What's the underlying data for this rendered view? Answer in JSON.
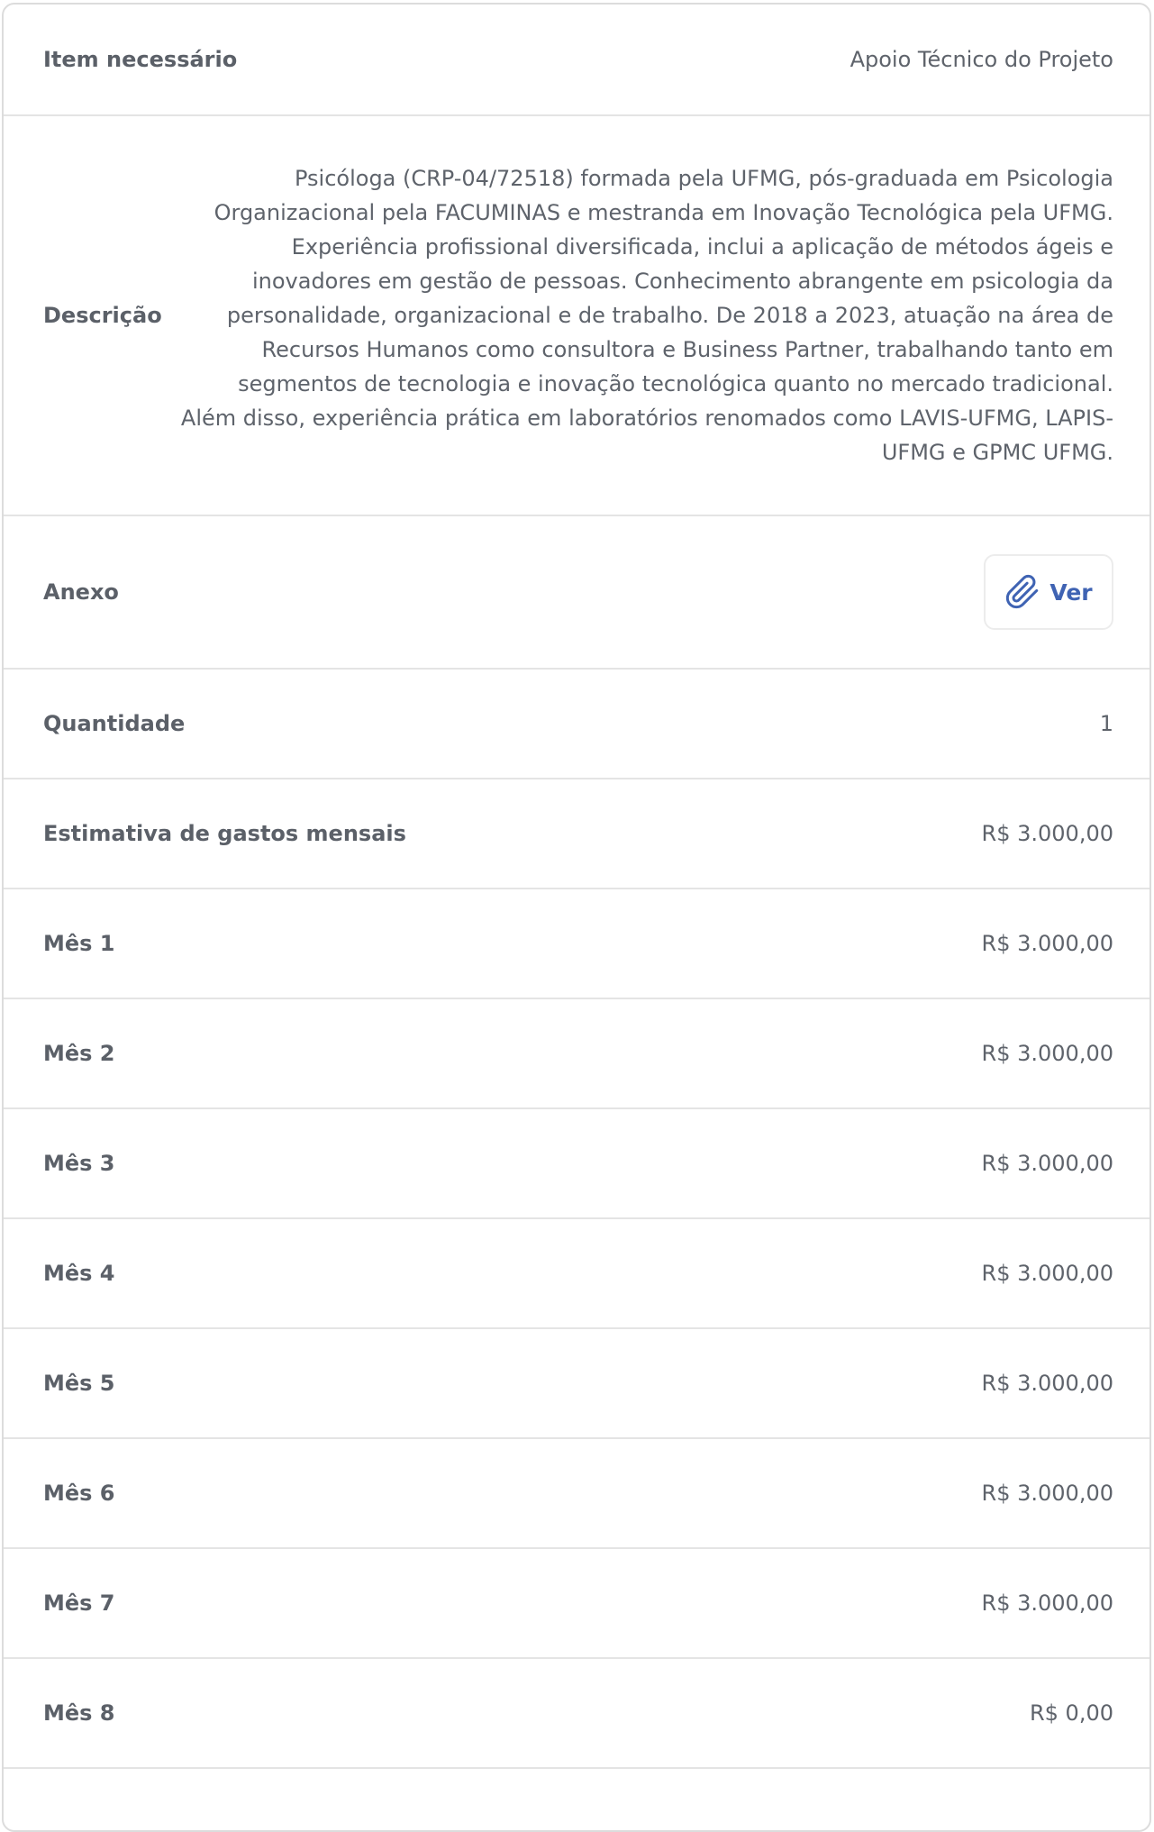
{
  "item": {
    "label": "Item necessário",
    "value": "Apoio Técnico do Projeto"
  },
  "descricao": {
    "label": "Descrição",
    "value": "Psicóloga (CRP-04/72518) formada pela UFMG, pós-graduada em Psicologia Organizacional pela FACUMINAS e mestranda em Inovação Tecnológica pela UFMG. Experiência profissional diversificada, inclui a aplicação de métodos ágeis e inovadores em gestão de pessoas. Conhecimento abrangente em psicologia da personalidade, organizacional e de trabalho. De 2018 a 2023, atuação na área de Recursos Humanos como consultora e Business Partner, trabalhando tanto em segmentos de tecnologia e inovação tecnológica quanto no mercado tradicional. Além disso, experiência prática em laboratórios renomados como LAVIS-UFMG, LAPIS-UFMG e GPMC UFMG."
  },
  "anexo": {
    "label": "Anexo",
    "button_label": "Ver",
    "button_icon": "paperclip-icon",
    "accent_color": "#3f63b3"
  },
  "quantidade": {
    "label": "Quantidade",
    "value": "1"
  },
  "estimativa": {
    "label": "Estimativa de gastos mensais",
    "value": "R$ 3.000,00"
  },
  "meses": [
    {
      "label": "Mês 1",
      "value": "R$ 3.000,00"
    },
    {
      "label": "Mês 2",
      "value": "R$ 3.000,00"
    },
    {
      "label": "Mês 3",
      "value": "R$ 3.000,00"
    },
    {
      "label": "Mês 4",
      "value": "R$ 3.000,00"
    },
    {
      "label": "Mês 5",
      "value": "R$ 3.000,00"
    },
    {
      "label": "Mês 6",
      "value": "R$ 3.000,00"
    },
    {
      "label": "Mês 7",
      "value": "R$ 3.000,00"
    },
    {
      "label": "Mês 8",
      "value": "R$ 0,00"
    }
  ]
}
